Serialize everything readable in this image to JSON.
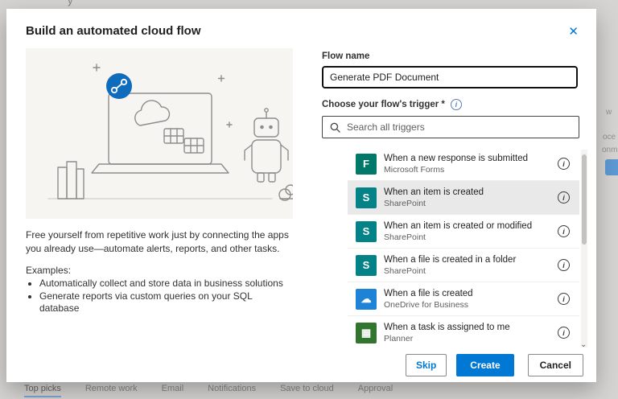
{
  "glyphs": {
    "close": "✕",
    "check": "✓",
    "info": "i",
    "scroll_down": "⌄"
  },
  "background": {
    "top_fragment": "y",
    "tabs": [
      "Top picks",
      "Remote work",
      "Email",
      "Notifications",
      "Save to cloud",
      "Approval"
    ],
    "active_tab": "Top picks",
    "right_fragments": [
      "w",
      "oce",
      "onm"
    ]
  },
  "dialog": {
    "title": "Build an automated cloud flow",
    "intro": {
      "description": "Free yourself from repetitive work just by connecting the apps you already use—automate alerts, reports, and other tasks.",
      "examples_label": "Examples:",
      "examples": [
        "Automatically collect and store data in business solutions",
        "Generate reports via custom queries on your SQL database"
      ]
    },
    "form": {
      "flow_name_label": "Flow name",
      "flow_name_value": "Generate PDF Document",
      "trigger_label": "Choose your flow's trigger *",
      "search_placeholder": "Search all triggers"
    },
    "triggers": [
      {
        "title": "When a new response is submitted",
        "service": "Microsoft Forms",
        "selected": false,
        "icon_glyph": "F",
        "icon_color": "#00786a"
      },
      {
        "title": "When an item is created",
        "service": "SharePoint",
        "selected": true,
        "icon_glyph": "S",
        "icon_color": "#038387"
      },
      {
        "title": "When an item is created or modified",
        "service": "SharePoint",
        "selected": false,
        "icon_glyph": "S",
        "icon_color": "#038387"
      },
      {
        "title": "When a file is created in a folder",
        "service": "SharePoint",
        "selected": false,
        "icon_glyph": "S",
        "icon_color": "#038387"
      },
      {
        "title": "When a file is created",
        "service": "OneDrive for Business",
        "selected": false,
        "icon_glyph": "☁",
        "icon_color": "#1e82d6"
      },
      {
        "title": "When a task is assigned to me",
        "service": "Planner",
        "selected": false,
        "icon_glyph": "▦",
        "icon_color": "#31752f"
      }
    ],
    "colors": {
      "accent": "#0078d4",
      "selected_row_bg": "#e9e9e9"
    },
    "footer": {
      "skip_label": "Skip",
      "create_label": "Create",
      "cancel_label": "Cancel"
    }
  }
}
